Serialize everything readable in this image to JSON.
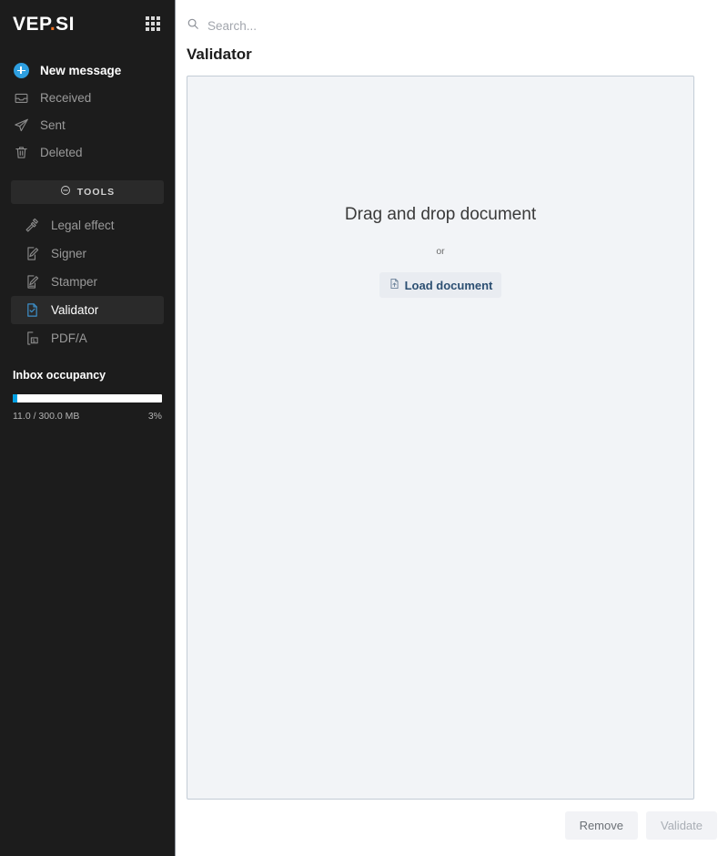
{
  "brand": {
    "logo_prefix": "VEP",
    "logo_dot": ".",
    "logo_suffix": "SI",
    "apps_icon": "grid-apps-icon"
  },
  "search": {
    "placeholder": "Search...",
    "value": "",
    "icon": "search-icon"
  },
  "sidebar": {
    "primary_action": {
      "label": "New message",
      "icon": "plus-circle-icon"
    },
    "mail_items": [
      {
        "label": "Received",
        "icon": "inbox-tray-icon"
      },
      {
        "label": "Sent",
        "icon": "paper-plane-icon"
      },
      {
        "label": "Deleted",
        "icon": "trash-can-icon"
      }
    ],
    "tools_header": {
      "label": "TOOLS",
      "icon": "minus-circle-icon"
    },
    "tools": [
      {
        "label": "Legal effect",
        "icon": "gavel-icon",
        "active": false
      },
      {
        "label": "Signer",
        "icon": "document-pen-icon",
        "active": false
      },
      {
        "label": "Stamper",
        "icon": "document-stamp-icon",
        "active": false
      },
      {
        "label": "Validator",
        "icon": "document-check-icon",
        "active": true
      },
      {
        "label": "PDF/A",
        "icon": "document-pdfa-icon",
        "active": false
      }
    ],
    "occupancy": {
      "title": "Inbox occupancy",
      "used_label": "11.0 / 300.0 MB",
      "percent_label": "3%",
      "percent_value": 3,
      "bar_color": "#00a0e3"
    }
  },
  "main": {
    "page_title": "Validator",
    "dropzone": {
      "title": "Drag and drop document",
      "or_label": "or",
      "load_button": {
        "label": "Load document",
        "icon": "document-upload-icon"
      }
    },
    "actions": [
      {
        "label": "Remove",
        "name": "remove-button",
        "disabled": false
      },
      {
        "label": "Validate",
        "name": "validate-button",
        "disabled": true
      }
    ]
  },
  "colors": {
    "sidebar_bg": "#1c1c1c",
    "accent_blue": "#2e9fe0",
    "brand_orange": "#f07020",
    "dropzone_bg": "#f2f4f7"
  }
}
